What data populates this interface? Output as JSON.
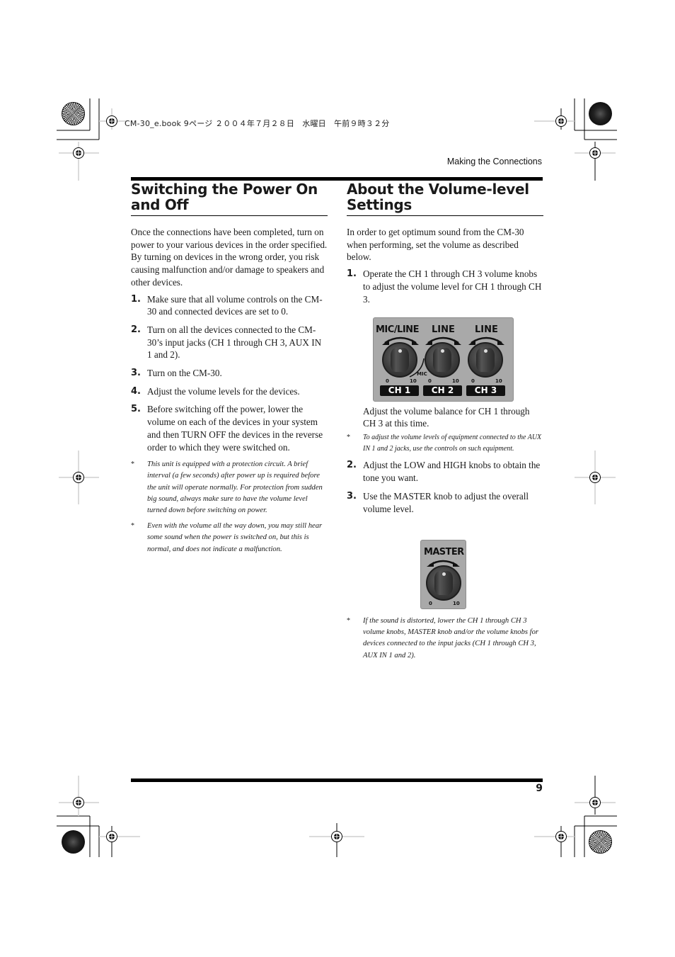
{
  "print_header": "CM-30_e.book  9ページ  ２００４年７月２８日　水曜日　午前９時３２分",
  "running_head": "Making the Connections",
  "page_number": "9",
  "left_section": {
    "title": "Switching the Power On and Off",
    "intro": "Once the connections have been completed, turn on power to your various devices in the order specified. By turning on devices in the wrong order, you risk causing malfunction and/or damage to speakers and other devices.",
    "steps": [
      {
        "num": "1.",
        "text": "Make sure that all volume controls on the CM-30 and connected devices are set to 0."
      },
      {
        "num": "2.",
        "text": "Turn on all the devices connected to the CM-30’s input jacks (CH 1 through CH 3, AUX IN 1 and 2)."
      },
      {
        "num": "3.",
        "text": "Turn on the CM-30."
      },
      {
        "num": "4.",
        "text": "Adjust the volume levels for the devices."
      },
      {
        "num": "5.",
        "text": "Before switching off the power, lower the volume on each of the devices in your system and then TURN OFF the devices in the reverse order to which they were switched on."
      }
    ],
    "notes": [
      {
        "mark": "*",
        "text": "This unit is equipped with a protection circuit. A brief interval (a few seconds) after power up is required before the unit will operate normally. For protection from sudden big sound, always make sure to have the volume level turned down before switching on power."
      },
      {
        "mark": "*",
        "text": "Even with the volume all the way down, you may still hear some sound when the power is switched on, but this is normal, and does not indicate a malfunction."
      }
    ]
  },
  "right_section": {
    "title": "About the Volume-level Settings",
    "intro": "In order to get optimum sound from the CM-30 when performing, set the volume as described below.",
    "step1": {
      "num": "1.",
      "text": "Operate the CH 1 through CH 3 volume knobs to adjust the volume level for CH 1 through CH 3."
    },
    "channel_panel": {
      "channels": [
        {
          "top_label": "MIC/LINE",
          "name": "CH 1",
          "min": "0",
          "max": "10",
          "extra": "MIC"
        },
        {
          "top_label": "LINE",
          "name": "CH 2",
          "min": "0",
          "max": "10"
        },
        {
          "top_label": "LINE",
          "name": "CH 3",
          "min": "0",
          "max": "10"
        }
      ]
    },
    "after_panel": "Adjust the volume balance for CH 1 through CH 3 at this time.",
    "note1": {
      "mark": "*",
      "text": "To adjust the volume levels of equipment connected to the AUX IN 1 and 2 jacks, use the controls on such equipment."
    },
    "step2": {
      "num": "2.",
      "text": "Adjust the LOW and HIGH knobs to obtain the tone you want."
    },
    "step3": {
      "num": "3.",
      "text": "Use the MASTER knob to adjust the overall volume level."
    },
    "master_panel": {
      "label": "MASTER",
      "min": "0",
      "max": "10"
    },
    "note2": {
      "mark": "*",
      "text": "If the sound is distorted, lower the CH 1 through CH 3 volume knobs, MASTER knob and/or the volume knobs for devices connected to the input jacks (CH 1 through CH 3, AUX IN 1 and 2)."
    }
  }
}
